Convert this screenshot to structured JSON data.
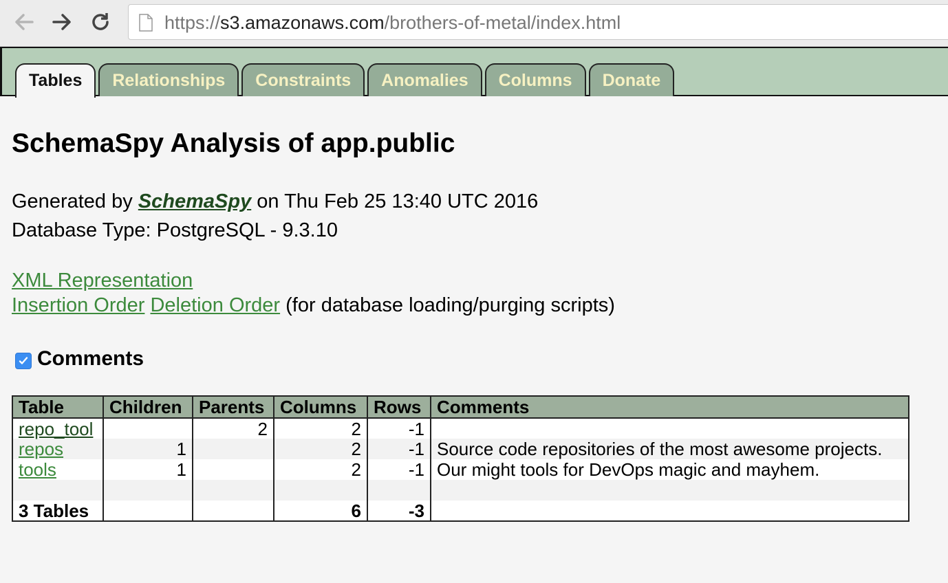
{
  "browser": {
    "url_scheme": "https://",
    "url_host": "s3.amazonaws.com",
    "url_path": "/brothers-of-metal/index.html",
    "icons": [
      "back-arrow-icon",
      "forward-arrow-icon",
      "reload-icon",
      "page-icon"
    ]
  },
  "tabs": [
    {
      "label": "Tables",
      "active": true
    },
    {
      "label": "Relationships"
    },
    {
      "label": "Constraints"
    },
    {
      "label": "Anomalies"
    },
    {
      "label": "Columns"
    },
    {
      "label": "Donate"
    }
  ],
  "page": {
    "title": "SchemaSpy Analysis of app.public",
    "generated_prefix": "Generated by ",
    "generated_link": "SchemaSpy",
    "generated_suffix": " on Thu Feb 25 13:40 UTC 2016",
    "db_type": "Database Type: PostgreSQL - 9.3.10",
    "xml_link": "XML Representation",
    "insertion_link": "Insertion Order",
    "deletion_link": "Deletion Order",
    "order_note": "(for database loading/purging scripts)",
    "comments_label": "Comments",
    "comments_checked": true
  },
  "table": {
    "headers": [
      "Table",
      "Children",
      "Parents",
      "Columns",
      "Rows",
      "Comments"
    ],
    "rows": [
      {
        "name": "repo_tool",
        "children": "",
        "parents": "2",
        "columns": "2",
        "rows": "-1",
        "comments": ""
      },
      {
        "name": "repos",
        "children": "1",
        "parents": "",
        "columns": "2",
        "rows": "-1",
        "comments": "Source code repositories of the most awesome projects."
      },
      {
        "name": "tools",
        "children": "1",
        "parents": "",
        "columns": "2",
        "rows": "-1",
        "comments": "Our might tools for DevOps magic and mayhem."
      }
    ],
    "total": {
      "label": "3 Tables",
      "columns": "6",
      "rows": "-3"
    }
  },
  "colors": {
    "tab_bg": "#95ad98",
    "tab_text": "#f6f1c2",
    "strip_bg": "#b5ceb8",
    "header_bg": "#9daf9c",
    "link": "#3c8a3c",
    "checkbox": "#3b8ef2"
  }
}
